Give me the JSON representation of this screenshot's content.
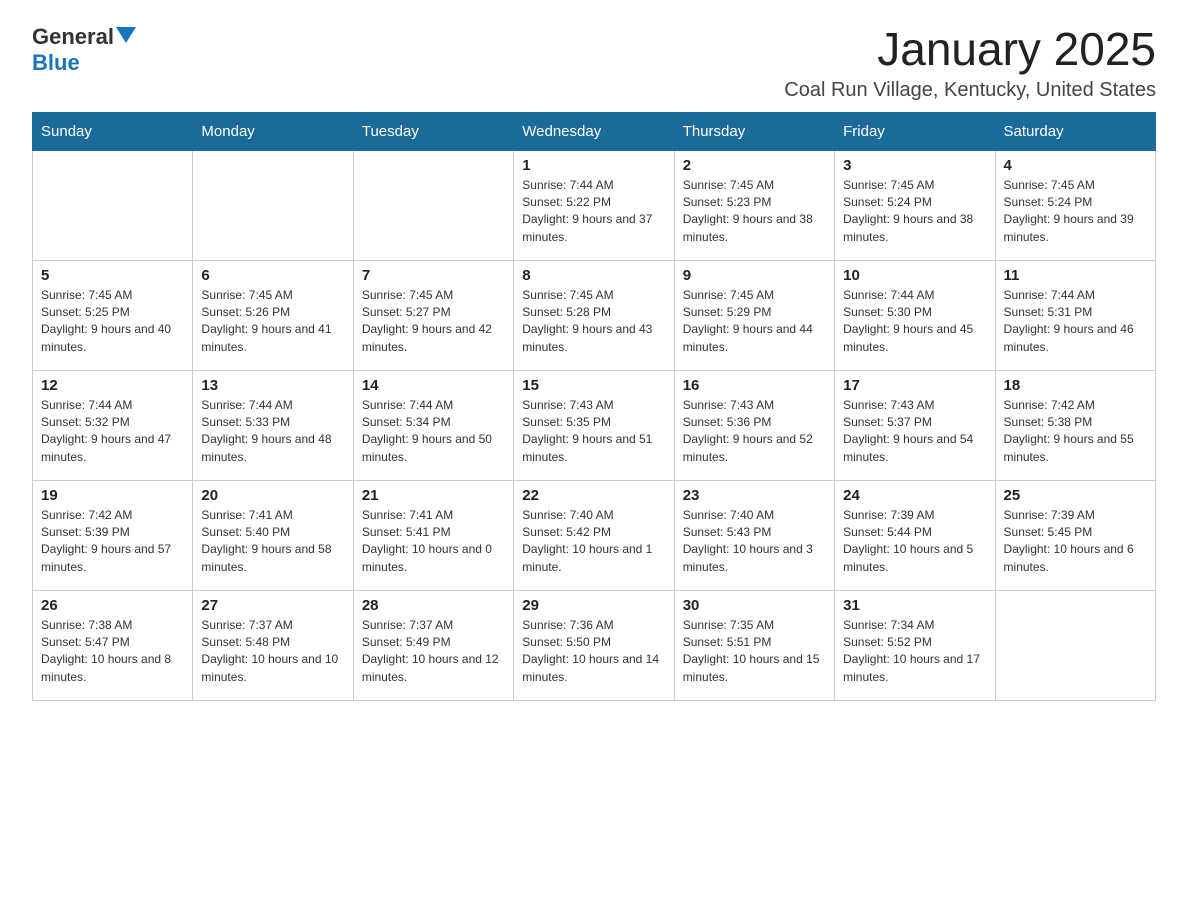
{
  "logo": {
    "text_general": "General",
    "text_blue": "Blue"
  },
  "title": "January 2025",
  "subtitle": "Coal Run Village, Kentucky, United States",
  "days_of_week": [
    "Sunday",
    "Monday",
    "Tuesday",
    "Wednesday",
    "Thursday",
    "Friday",
    "Saturday"
  ],
  "weeks": [
    [
      {
        "day": "",
        "info": ""
      },
      {
        "day": "",
        "info": ""
      },
      {
        "day": "",
        "info": ""
      },
      {
        "day": "1",
        "info": "Sunrise: 7:44 AM\nSunset: 5:22 PM\nDaylight: 9 hours and 37 minutes."
      },
      {
        "day": "2",
        "info": "Sunrise: 7:45 AM\nSunset: 5:23 PM\nDaylight: 9 hours and 38 minutes."
      },
      {
        "day": "3",
        "info": "Sunrise: 7:45 AM\nSunset: 5:24 PM\nDaylight: 9 hours and 38 minutes."
      },
      {
        "day": "4",
        "info": "Sunrise: 7:45 AM\nSunset: 5:24 PM\nDaylight: 9 hours and 39 minutes."
      }
    ],
    [
      {
        "day": "5",
        "info": "Sunrise: 7:45 AM\nSunset: 5:25 PM\nDaylight: 9 hours and 40 minutes."
      },
      {
        "day": "6",
        "info": "Sunrise: 7:45 AM\nSunset: 5:26 PM\nDaylight: 9 hours and 41 minutes."
      },
      {
        "day": "7",
        "info": "Sunrise: 7:45 AM\nSunset: 5:27 PM\nDaylight: 9 hours and 42 minutes."
      },
      {
        "day": "8",
        "info": "Sunrise: 7:45 AM\nSunset: 5:28 PM\nDaylight: 9 hours and 43 minutes."
      },
      {
        "day": "9",
        "info": "Sunrise: 7:45 AM\nSunset: 5:29 PM\nDaylight: 9 hours and 44 minutes."
      },
      {
        "day": "10",
        "info": "Sunrise: 7:44 AM\nSunset: 5:30 PM\nDaylight: 9 hours and 45 minutes."
      },
      {
        "day": "11",
        "info": "Sunrise: 7:44 AM\nSunset: 5:31 PM\nDaylight: 9 hours and 46 minutes."
      }
    ],
    [
      {
        "day": "12",
        "info": "Sunrise: 7:44 AM\nSunset: 5:32 PM\nDaylight: 9 hours and 47 minutes."
      },
      {
        "day": "13",
        "info": "Sunrise: 7:44 AM\nSunset: 5:33 PM\nDaylight: 9 hours and 48 minutes."
      },
      {
        "day": "14",
        "info": "Sunrise: 7:44 AM\nSunset: 5:34 PM\nDaylight: 9 hours and 50 minutes."
      },
      {
        "day": "15",
        "info": "Sunrise: 7:43 AM\nSunset: 5:35 PM\nDaylight: 9 hours and 51 minutes."
      },
      {
        "day": "16",
        "info": "Sunrise: 7:43 AM\nSunset: 5:36 PM\nDaylight: 9 hours and 52 minutes."
      },
      {
        "day": "17",
        "info": "Sunrise: 7:43 AM\nSunset: 5:37 PM\nDaylight: 9 hours and 54 minutes."
      },
      {
        "day": "18",
        "info": "Sunrise: 7:42 AM\nSunset: 5:38 PM\nDaylight: 9 hours and 55 minutes."
      }
    ],
    [
      {
        "day": "19",
        "info": "Sunrise: 7:42 AM\nSunset: 5:39 PM\nDaylight: 9 hours and 57 minutes."
      },
      {
        "day": "20",
        "info": "Sunrise: 7:41 AM\nSunset: 5:40 PM\nDaylight: 9 hours and 58 minutes."
      },
      {
        "day": "21",
        "info": "Sunrise: 7:41 AM\nSunset: 5:41 PM\nDaylight: 10 hours and 0 minutes."
      },
      {
        "day": "22",
        "info": "Sunrise: 7:40 AM\nSunset: 5:42 PM\nDaylight: 10 hours and 1 minute."
      },
      {
        "day": "23",
        "info": "Sunrise: 7:40 AM\nSunset: 5:43 PM\nDaylight: 10 hours and 3 minutes."
      },
      {
        "day": "24",
        "info": "Sunrise: 7:39 AM\nSunset: 5:44 PM\nDaylight: 10 hours and 5 minutes."
      },
      {
        "day": "25",
        "info": "Sunrise: 7:39 AM\nSunset: 5:45 PM\nDaylight: 10 hours and 6 minutes."
      }
    ],
    [
      {
        "day": "26",
        "info": "Sunrise: 7:38 AM\nSunset: 5:47 PM\nDaylight: 10 hours and 8 minutes."
      },
      {
        "day": "27",
        "info": "Sunrise: 7:37 AM\nSunset: 5:48 PM\nDaylight: 10 hours and 10 minutes."
      },
      {
        "day": "28",
        "info": "Sunrise: 7:37 AM\nSunset: 5:49 PM\nDaylight: 10 hours and 12 minutes."
      },
      {
        "day": "29",
        "info": "Sunrise: 7:36 AM\nSunset: 5:50 PM\nDaylight: 10 hours and 14 minutes."
      },
      {
        "day": "30",
        "info": "Sunrise: 7:35 AM\nSunset: 5:51 PM\nDaylight: 10 hours and 15 minutes."
      },
      {
        "day": "31",
        "info": "Sunrise: 7:34 AM\nSunset: 5:52 PM\nDaylight: 10 hours and 17 minutes."
      },
      {
        "day": "",
        "info": ""
      }
    ]
  ]
}
